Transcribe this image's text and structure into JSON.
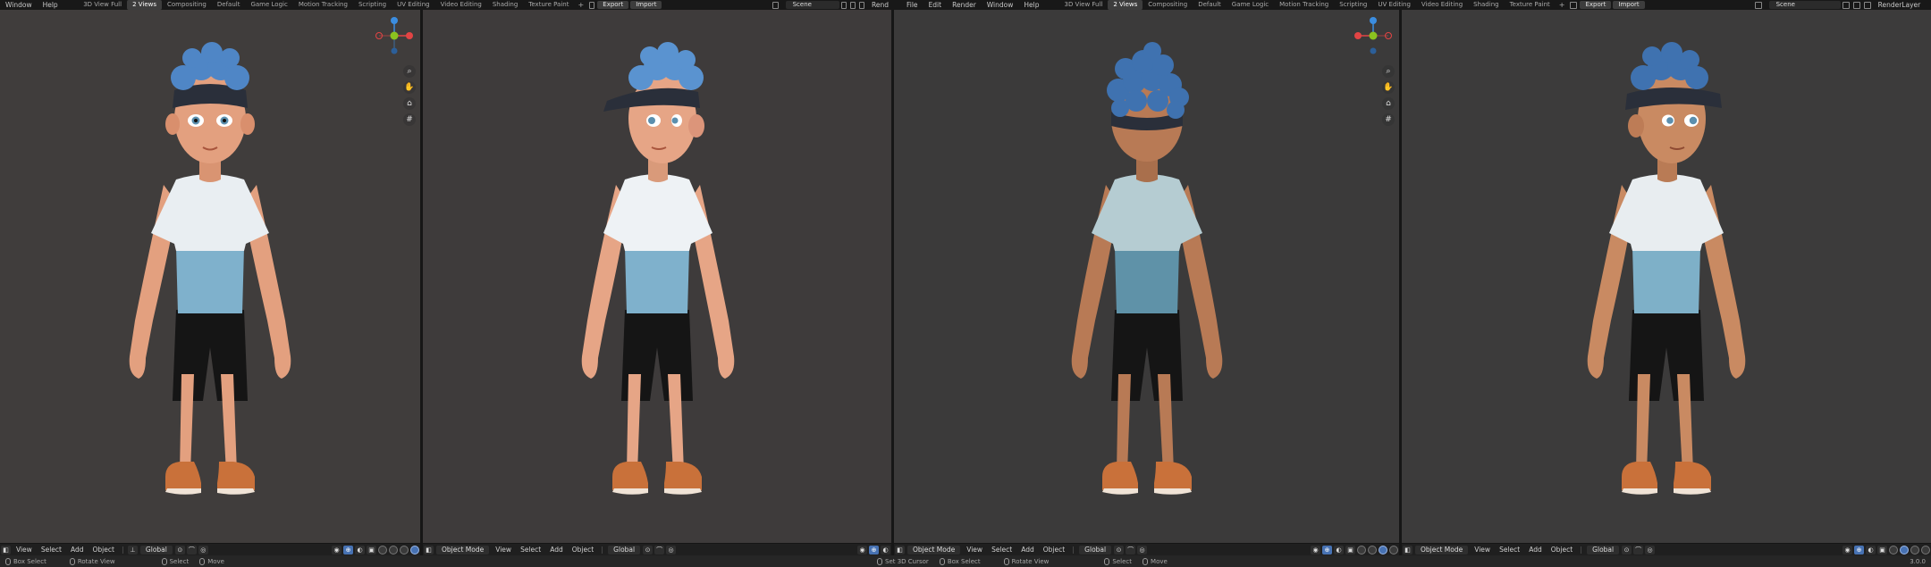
{
  "left_window": {
    "menu": [
      "Window",
      "Help"
    ],
    "workspaces": [
      "3D View Full",
      "2 Views",
      "Compositing",
      "Default",
      "Game Logic",
      "Motion Tracking",
      "Scripting",
      "UV Editing",
      "Video Editing",
      "Shading",
      "Texture Paint"
    ],
    "active_workspace": "2 Views",
    "export_label": "Export",
    "import_label": "Import",
    "scene_label": "Scene",
    "render_truncated": "Rend"
  },
  "right_window": {
    "menu": [
      "File",
      "Edit",
      "Render",
      "Window",
      "Help"
    ],
    "workspaces": [
      "3D View Full",
      "2 Views",
      "Compositing",
      "Default",
      "Game Logic",
      "Motion Tracking",
      "Scripting",
      "UV Editing",
      "Video Editing",
      "Shading",
      "Texture Paint"
    ],
    "active_workspace": "2 Views",
    "export_label": "Export",
    "import_label": "Import",
    "scene_label": "Scene",
    "render_layer_label": "RenderLayer"
  },
  "viewport_header": {
    "view": "View",
    "select": "Select",
    "add": "Add",
    "object": "Object",
    "object_mode": "Object Mode",
    "transform_orientation": "Global"
  },
  "status_left": {
    "box_select": "Box Select",
    "rotate_view": "Rotate View",
    "select": "Select",
    "move": "Move"
  },
  "status_right": {
    "set_3d_cursor": "Set 3D Cursor",
    "box_select": "Box Select",
    "rotate_view": "Rotate View",
    "select": "Select",
    "move": "Move",
    "version": "3.0.0"
  },
  "icons": {
    "zoom": "zoom-icon",
    "pan": "hand-icon",
    "camera": "camera-icon",
    "grid": "grid-icon"
  },
  "colors": {
    "shirt_top": "#e9eef2",
    "shirt_bottom": "#7fb1cc",
    "hair": "#4f86c6",
    "cap": "#2a2f3a",
    "shorts": "#151515",
    "shoes": "#c9713a",
    "skin": "#e3a07f",
    "skin_tan": "#c98a62",
    "active": "#4772b3",
    "axis_x": "#e24444",
    "axis_y": "#8bc21f",
    "axis_z": "#3b8de0"
  }
}
